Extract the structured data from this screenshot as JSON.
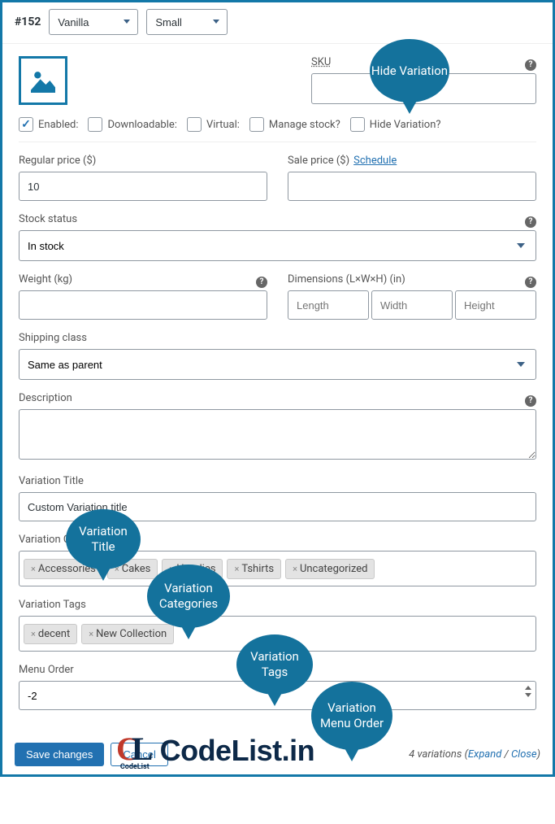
{
  "header": {
    "id": "#152",
    "attr1": "Vanilla",
    "attr2": "Small"
  },
  "sku_label": "SKU",
  "checks": {
    "enabled": "Enabled:",
    "downloadable": "Downloadable:",
    "virtual": "Virtual:",
    "manage_stock": "Manage stock?",
    "hide": "Hide Variation?"
  },
  "regular_price": {
    "label": "Regular price ($)",
    "value": "10"
  },
  "sale_price": {
    "label": "Sale price ($)",
    "schedule": "Schedule"
  },
  "stock_status": {
    "label": "Stock status",
    "value": "In stock"
  },
  "weight": {
    "label": "Weight (kg)"
  },
  "dimensions": {
    "label": "Dimensions (L×W×H) (in)",
    "ph_l": "Length",
    "ph_w": "Width",
    "ph_h": "Height"
  },
  "shipping_class": {
    "label": "Shipping class",
    "value": "Same as parent"
  },
  "description": {
    "label": "Description"
  },
  "variation_title": {
    "label": "Variation Title",
    "value": "Custom Variation title"
  },
  "variation_categories": {
    "label": "Variation Categories",
    "items": [
      "Accessories",
      "Cakes",
      "Hoodies",
      "Tshirts",
      "Uncategorized"
    ]
  },
  "variation_tags": {
    "label": "Variation Tags",
    "items": [
      "decent",
      "New Collection"
    ]
  },
  "menu_order": {
    "label": "Menu Order",
    "value": "-2"
  },
  "footer": {
    "save": "Save changes",
    "cancel": "Cancel",
    "right_a": "4 variations (",
    "expand": "Expand",
    "sep": " / ",
    "close": "Close",
    "right_b": ")"
  },
  "bubbles": {
    "hide": "Hide Variation",
    "title": "Variation Title",
    "cats": "Variation Categories",
    "tags": "Variation Tags",
    "menu": "Variation Menu Order"
  },
  "logo": {
    "text": "CodeList.in",
    "sub": "CodeList"
  }
}
